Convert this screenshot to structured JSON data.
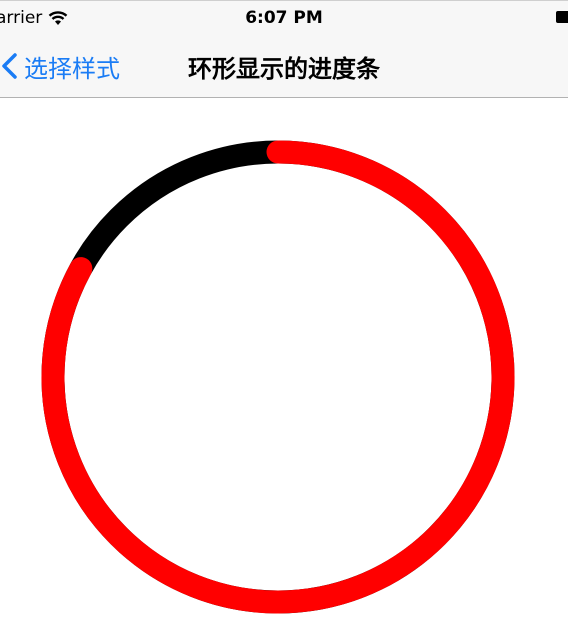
{
  "status_bar": {
    "carrier": "arrier",
    "time": "6:07 PM",
    "wifi_icon": "wifi-icon",
    "battery_icon": "battery-icon"
  },
  "nav": {
    "back_label": "选择样式",
    "back_icon": "chevron-left-icon",
    "title": "环形显示的进度条"
  },
  "progress": {
    "value": 0.83,
    "track_color": "#000000",
    "progress_color": "#ff0000",
    "accent_color": "#1a7cf5"
  }
}
